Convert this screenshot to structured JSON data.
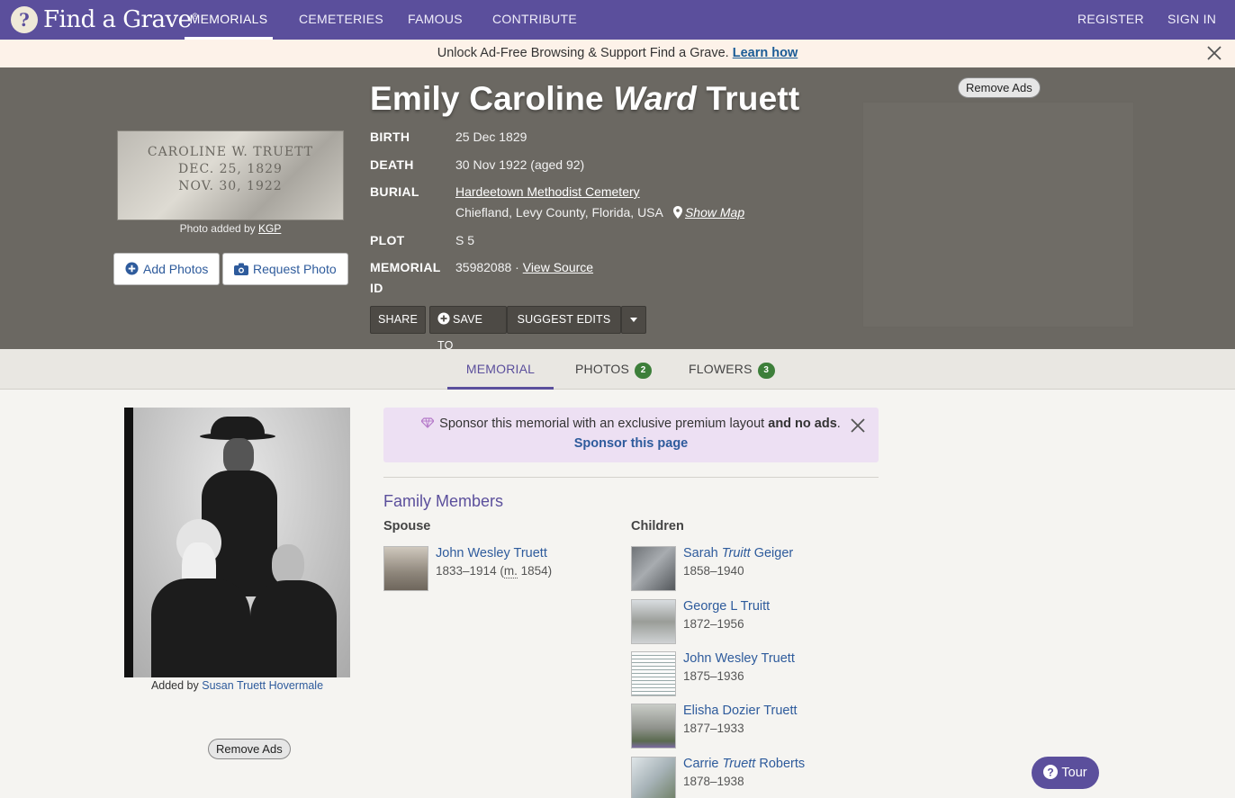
{
  "nav": {
    "logo_text": "Find a Grave",
    "items": [
      "MEMORIALS",
      "CEMETERIES",
      "FAMOUS",
      "CONTRIBUTE"
    ],
    "register": "REGISTER",
    "sign_in": "SIGN IN",
    "accent": "#5b4f9c"
  },
  "promo": {
    "text": "Unlock Ad-Free Browsing & Support Find a Grave.",
    "link": "Learn how"
  },
  "memorial": {
    "name_first": "Emily Caroline",
    "name_maiden": "Ward",
    "name_last": "Truett",
    "photo_engraving": [
      "CAROLINE W. TRUETT",
      "DEC. 25, 1829",
      "NOV. 30, 1922"
    ],
    "photo_caption": "Photo added by",
    "photo_caption_user": "KGP",
    "add_photos": "Add Photos",
    "request_photo": "Request Photo",
    "facts": {
      "birth_label": "BIRTH",
      "birth_value": "25 Dec 1829",
      "death_label": "DEATH",
      "death_value": "30 Nov 1922 (aged 92)",
      "burial_label": "BURIAL",
      "burial_cemetery": "Hardeetown Methodist Cemetery",
      "burial_location": "Chiefland, Levy County, Florida, USA",
      "show_map": "Show Map",
      "plot_label": "PLOT",
      "plot_value": "S 5",
      "memorial_label_1": "MEMORIAL",
      "memorial_label_2": "ID",
      "memorial_id": "35982088 ·",
      "view_source": "View Source"
    },
    "actions": {
      "share": "SHARE",
      "save_to": "SAVE TO",
      "suggest_edits": "SUGGEST EDITS"
    },
    "remove_ads": "Remove Ads"
  },
  "tabs": [
    {
      "label": "MEMORIAL"
    },
    {
      "label": "PHOTOS",
      "count": "2"
    },
    {
      "label": "FLOWERS",
      "count": "3"
    }
  ],
  "main_photo": {
    "added_by_label": "Added by",
    "added_by_user": "Susan Truett Hovermale"
  },
  "sponsor": {
    "text": "Sponsor this memorial with an exclusive premium layout",
    "bold": "and no ads",
    "end": ".",
    "link": "Sponsor this page"
  },
  "family": {
    "title": "Family Members",
    "spouse_heading": "Spouse",
    "children_heading": "Children",
    "spouse": [
      {
        "first": "John Wesley Truett",
        "maiden": "",
        "last": "",
        "dates": "1833–1914 (",
        "m": "m.",
        "m_year": " 1854)"
      }
    ],
    "children": [
      {
        "first": "Sarah",
        "maiden": "Truitt",
        "last": "Geiger",
        "dates": "1858–1940"
      },
      {
        "first": "George L Truitt",
        "maiden": "",
        "last": "",
        "dates": "1872–1956"
      },
      {
        "first": "John Wesley Truett",
        "maiden": "",
        "last": "",
        "dates": "1875–1936"
      },
      {
        "first": "Elisha Dozier Truett",
        "maiden": "",
        "last": "",
        "dates": "1877–1933"
      },
      {
        "first": "Carrie",
        "maiden": "Truett",
        "last": "Roberts",
        "dates": "1878–1938"
      }
    ]
  },
  "remove_ads_bottom": "Remove Ads",
  "tour": "Tour"
}
